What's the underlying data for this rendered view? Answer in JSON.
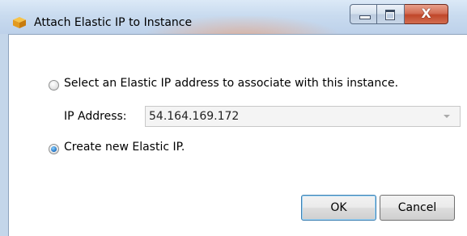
{
  "window": {
    "title": "Attach Elastic IP to Instance",
    "app_icon": "aws-cube-icon",
    "controls": {
      "minimize_icon": "minimize-icon",
      "maximize_icon": "maximize-icon",
      "close_label": "X"
    }
  },
  "form": {
    "option_select": {
      "label": "Select an Elastic IP address to associate with this instance.",
      "checked": false
    },
    "ip_address": {
      "label": "IP Address:",
      "value": "54.164.169.172",
      "enabled": false
    },
    "option_create": {
      "label": "Create new Elastic IP.",
      "checked": true
    }
  },
  "buttons": {
    "ok_label": "OK",
    "cancel_label": "Cancel"
  },
  "colors": {
    "close_button": "#c0472a",
    "radio_checked": "#1b6fc2",
    "default_button_border": "#3c7fb1"
  }
}
